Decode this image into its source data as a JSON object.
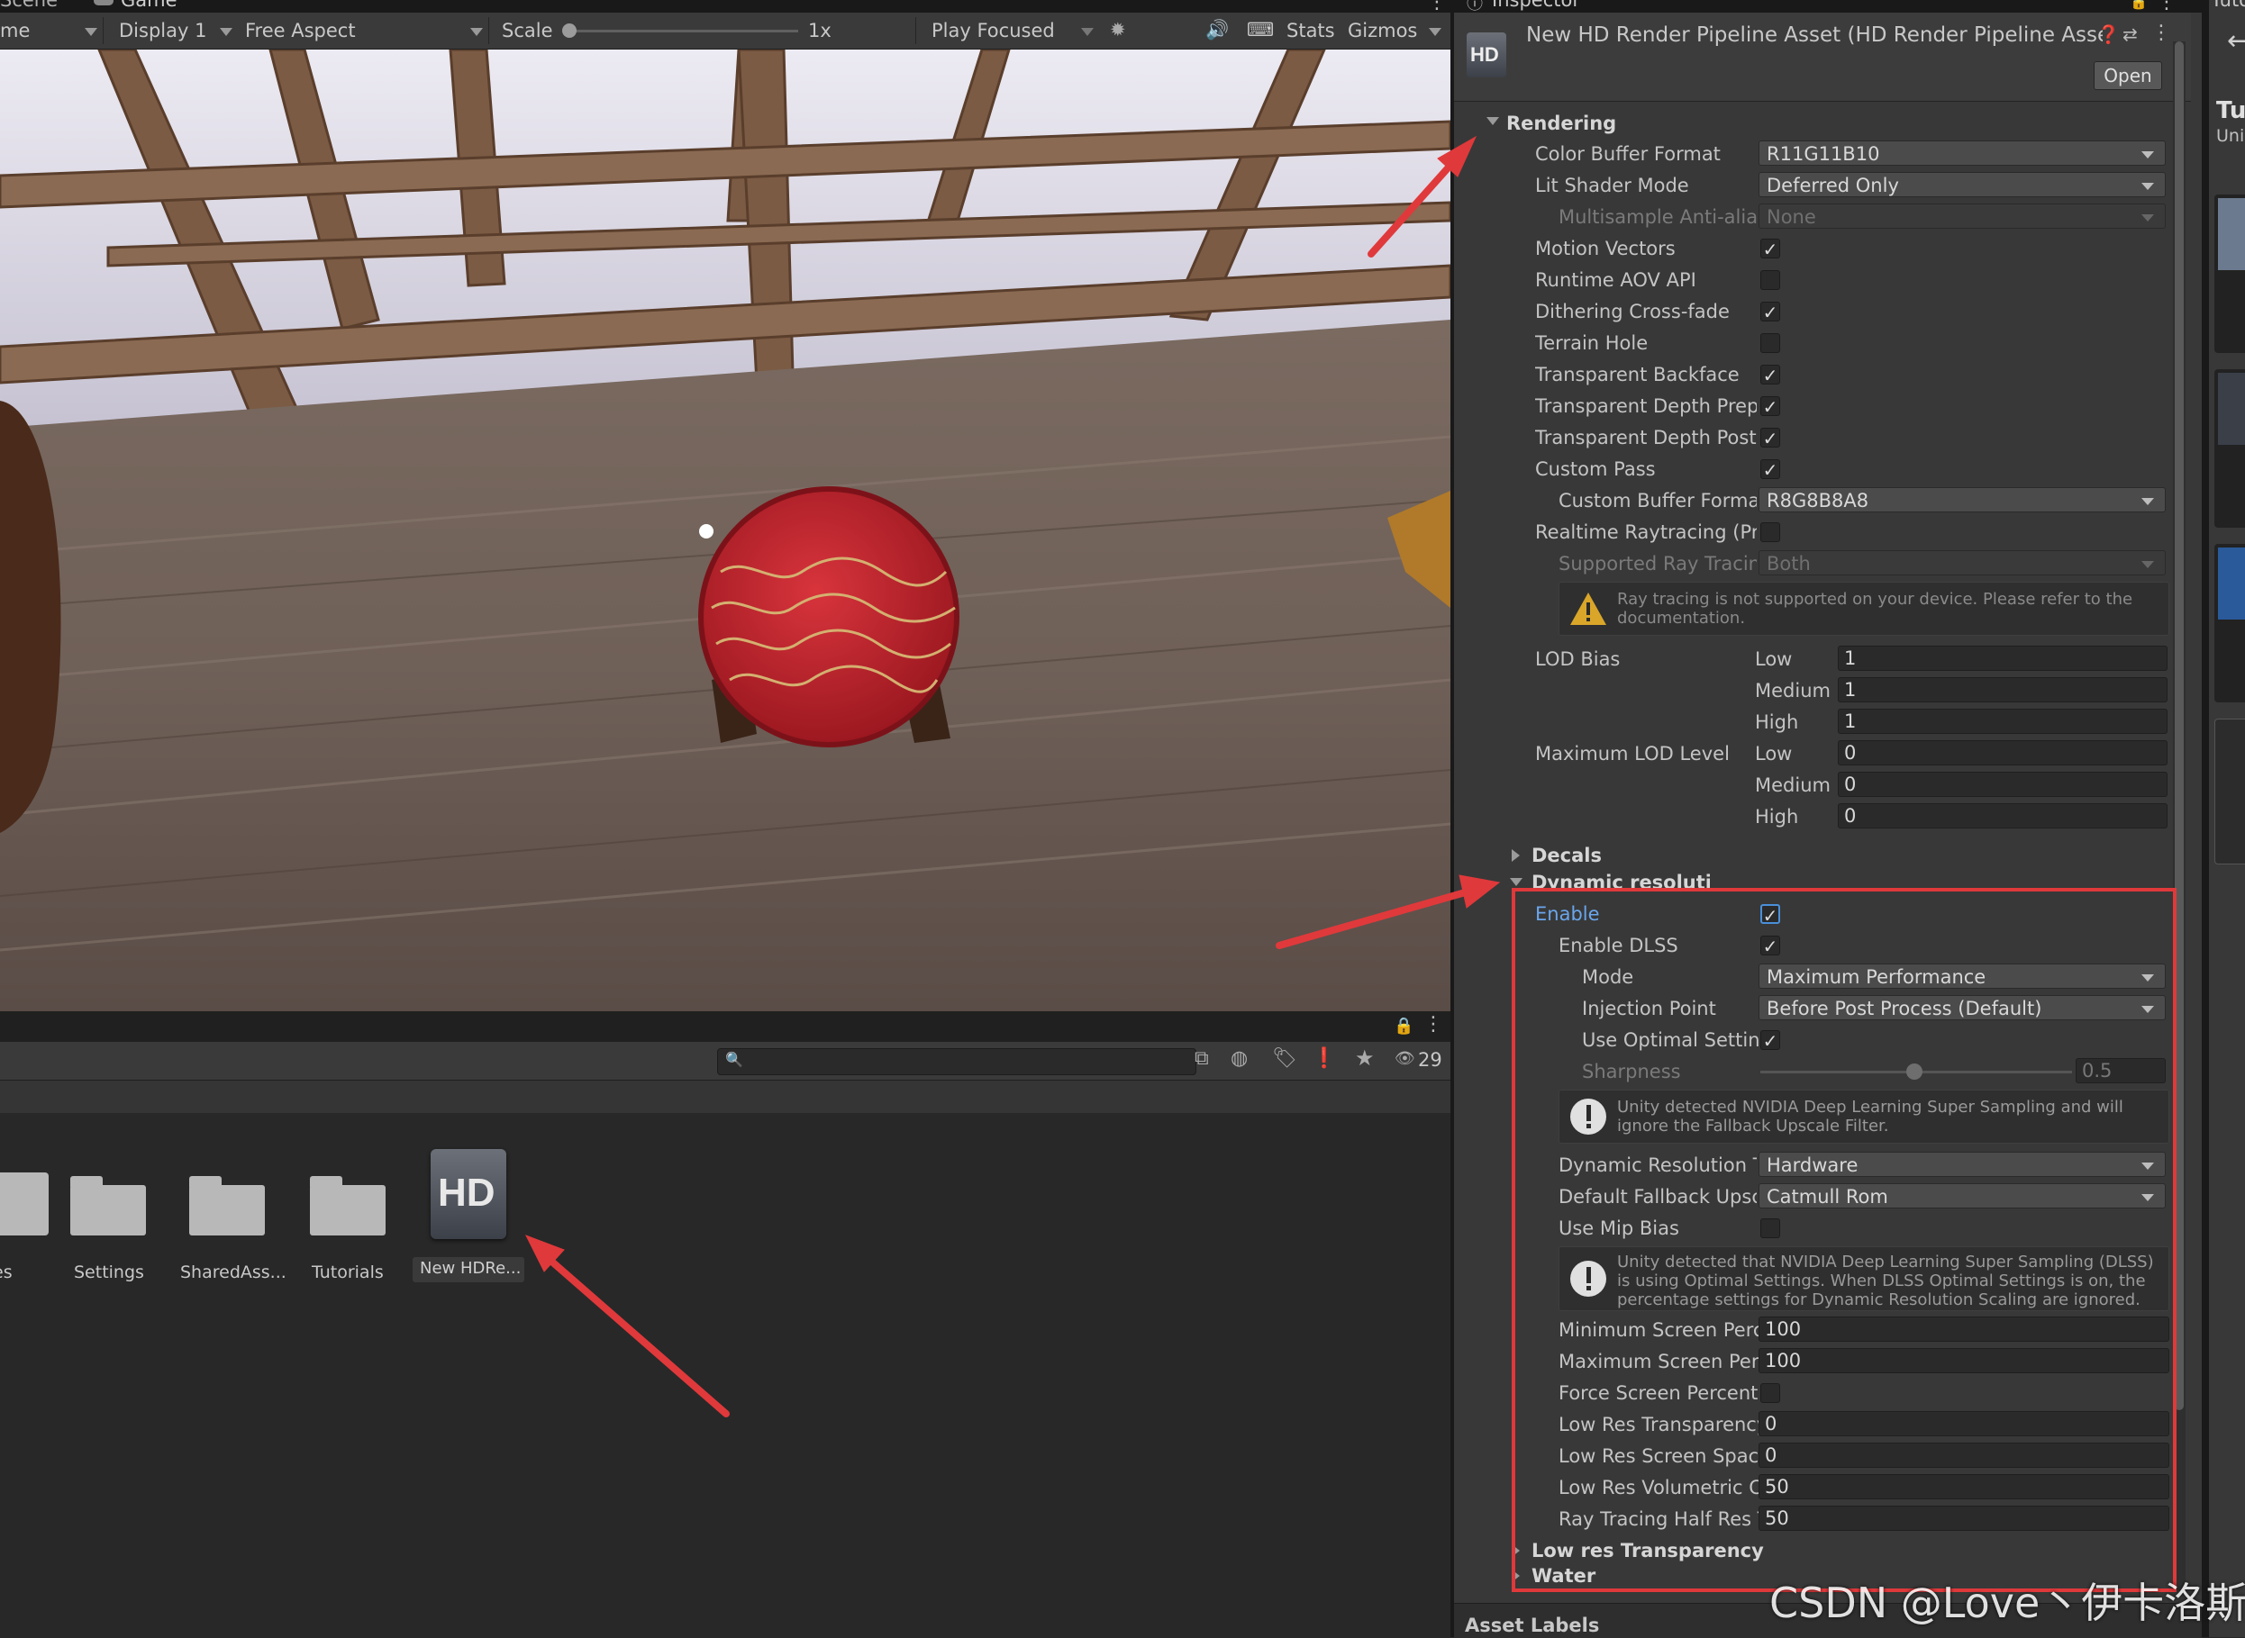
{
  "game_view": {
    "tab_scene": "Scene",
    "tab_game": "Game",
    "mode_label": "me",
    "display": "Display 1",
    "aspect": "Free Aspect",
    "scale_label": "Scale",
    "scale_value": "1x",
    "play_mode": "Play Focused",
    "stats": "Stats",
    "gizmos": "Gizmos"
  },
  "project": {
    "search_placeholder": "",
    "hidden_count": "29",
    "items": [
      {
        "name": "es",
        "icon": "folder-icon"
      },
      {
        "name": "Settings",
        "icon": "folder-icon"
      },
      {
        "name": "SharedAss...",
        "icon": "folder-icon"
      },
      {
        "name": "Tutorials",
        "icon": "folder-icon"
      },
      {
        "name": "New HDRe...",
        "icon": "hd-asset-icon"
      }
    ]
  },
  "inspector": {
    "tab": "Inspector",
    "title": "New HD Render Pipeline Asset (HD Render Pipeline Asse",
    "badge": "HD",
    "open_button": "Open",
    "rendering": {
      "header": "Rendering",
      "color_buffer_format_label": "Color Buffer Format",
      "color_buffer_format": "R11G11B10",
      "lit_shader_mode_label": "Lit Shader Mode",
      "lit_shader_mode": "Deferred Only",
      "msaa_label": "Multisample Anti-alias",
      "msaa": "None",
      "motion_vectors": "Motion Vectors",
      "runtime_aov": "Runtime AOV API",
      "dithering": "Dithering Cross-fade",
      "terrain_hole": "Terrain Hole",
      "transparent_backface": "Transparent Backface",
      "transparent_depth_prepass": "Transparent Depth Prepa",
      "transparent_depth_postpass": "Transparent Depth Postp",
      "custom_pass": "Custom Pass",
      "custom_buffer_format_label": "Custom Buffer Format",
      "custom_buffer_format": "R8G8B8A8",
      "realtime_raytracing": "Realtime Raytracing (Pre",
      "supported_raytracing_label": "Supported Ray Tracing",
      "supported_raytracing": "Both",
      "raytracing_warning": "Ray tracing is not supported on your device. Please refer to the documentation.",
      "lod_bias_label": "LOD Bias",
      "max_lod_label": "Maximum LOD Level",
      "low": "Low",
      "medium": "Medium",
      "high": "High",
      "lod_bias": [
        "1",
        "1",
        "1"
      ],
      "max_lod": [
        "0",
        "0",
        "0"
      ]
    },
    "decals_header": "Decals",
    "dynamic_resolution": {
      "header": "Dynamic resolution",
      "enable": "Enable",
      "enable_dlss": "Enable DLSS",
      "mode_label": "Mode",
      "mode": "Maximum Performance",
      "injection_point_label": "Injection Point",
      "injection_point": "Before Post Process (Default)",
      "use_optimal_settings": "Use Optimal Setting",
      "sharpness_label": "Sharpness",
      "sharpness": "0.5",
      "dlss_info": "Unity detected NVIDIA Deep Learning Super Sampling and will ignore the Fallback Upscale Filter.",
      "dr_type_label": "Dynamic Resolution Ty",
      "dr_type": "Hardware",
      "fallback_label": "Default Fallback Upsc",
      "fallback": "Catmull Rom",
      "use_mip_bias": "Use Mip Bias",
      "optimal_info": "Unity detected that NVIDIA Deep Learning Super Sampling (DLSS) is using Optimal Settings. When DLSS Optimal Settings is on, the percentage settings for Dynamic Resolution Scaling are ignored.",
      "min_screen_label": "Minimum Screen Perc",
      "min_screen": "100",
      "max_screen_label": "Maximum Screen Perc",
      "max_screen": "100",
      "force_screen_label": "Force Screen Percenta",
      "low_res_transparency_label": "Low Res Transparency",
      "low_res_transparency": "0",
      "low_res_ssr_label": "Low Res Screen Spac",
      "low_res_ssr": "0",
      "low_res_volumetric_label": "Low Res Volumetric C",
      "low_res_volumetric": "50",
      "rt_half_res_label": "Ray Tracing Half Res T",
      "rt_half_res": "50"
    },
    "low_res_transparency_header": "Low res Transparency",
    "water_header": "Water",
    "asset_labels": "Asset Labels"
  },
  "right_panel": {
    "tab": "Tuto",
    "title": "Tu",
    "subtitle": "Uni"
  },
  "watermark": "CSDN @Love丶伊卡洛斯",
  "colors": {
    "highlight_red": "#e0393b",
    "accent_blue": "#4a90d9",
    "panel_bg": "#383838"
  }
}
